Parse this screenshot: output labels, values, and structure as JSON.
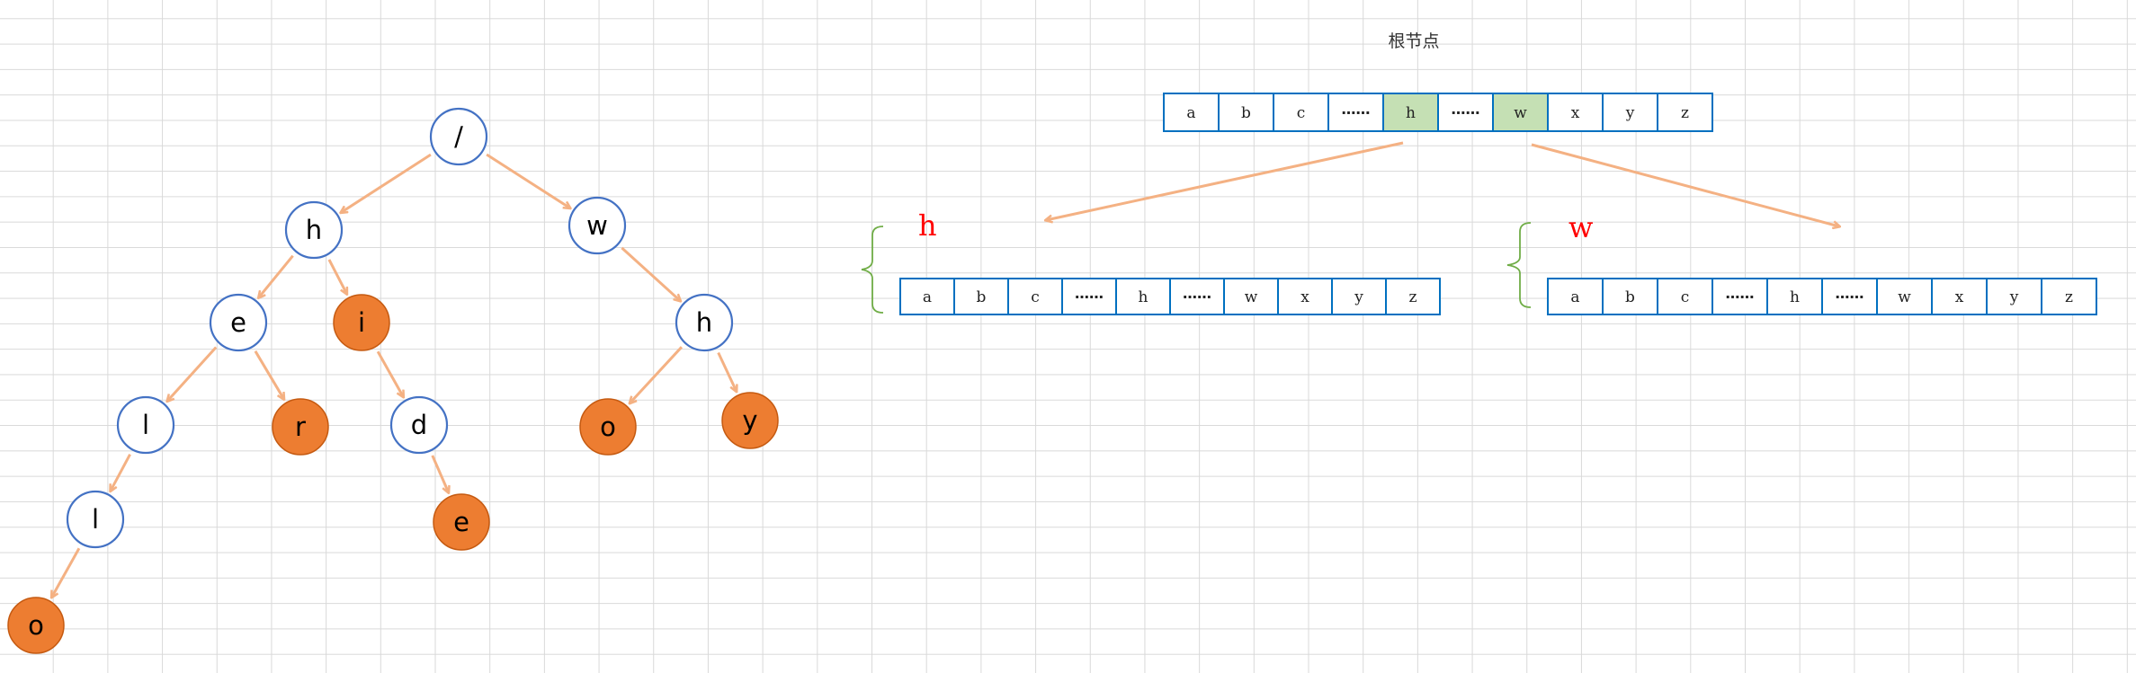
{
  "trie_tree": {
    "nodes": [
      {
        "id": "root",
        "label": "/",
        "terminal": false
      },
      {
        "id": "h",
        "label": "h",
        "terminal": false
      },
      {
        "id": "w",
        "label": "w",
        "terminal": false
      },
      {
        "id": "he",
        "label": "e",
        "terminal": false
      },
      {
        "id": "hi",
        "label": "i",
        "terminal": true
      },
      {
        "id": "wh",
        "label": "h",
        "terminal": false
      },
      {
        "id": "hel",
        "label": "l",
        "terminal": false
      },
      {
        "id": "her",
        "label": "r",
        "terminal": true
      },
      {
        "id": "hid",
        "label": "d",
        "terminal": false
      },
      {
        "id": "who",
        "label": "o",
        "terminal": true
      },
      {
        "id": "why",
        "label": "y",
        "terminal": true
      },
      {
        "id": "hell",
        "label": "l",
        "terminal": false
      },
      {
        "id": "hide",
        "label": "e",
        "terminal": true
      },
      {
        "id": "hello",
        "label": "o",
        "terminal": true
      }
    ],
    "edges": [
      [
        "root",
        "h"
      ],
      [
        "root",
        "w"
      ],
      [
        "h",
        "he"
      ],
      [
        "h",
        "hi"
      ],
      [
        "w",
        "wh"
      ],
      [
        "he",
        "hel"
      ],
      [
        "he",
        "her"
      ],
      [
        "hi",
        "hid"
      ],
      [
        "wh",
        "who"
      ],
      [
        "wh",
        "why"
      ],
      [
        "hel",
        "hell"
      ],
      [
        "hid",
        "hide"
      ],
      [
        "hell",
        "hello"
      ]
    ]
  },
  "array_diagram": {
    "root_label": "根节点",
    "root_cells": [
      "a",
      "b",
      "c",
      "……",
      "h",
      "……",
      "w",
      "x",
      "y",
      "z"
    ],
    "highlighted": [
      "h",
      "w"
    ],
    "children": [
      {
        "label": "h",
        "cells": [
          "a",
          "b",
          "c",
          "……",
          "h",
          "……",
          "w",
          "x",
          "y",
          "z"
        ]
      },
      {
        "label": "w",
        "cells": [
          "a",
          "b",
          "c",
          "……",
          "h",
          "……",
          "w",
          "x",
          "y",
          "z"
        ]
      }
    ]
  },
  "colors": {
    "edge": "#f4b183",
    "terminal_fill": "#ed7d31",
    "node_border": "#4472c4",
    "cell_border": "#0070c0",
    "highlight_fill": "#c5e0b4",
    "child_label": "#ff0000",
    "brace": "#70ad47"
  }
}
